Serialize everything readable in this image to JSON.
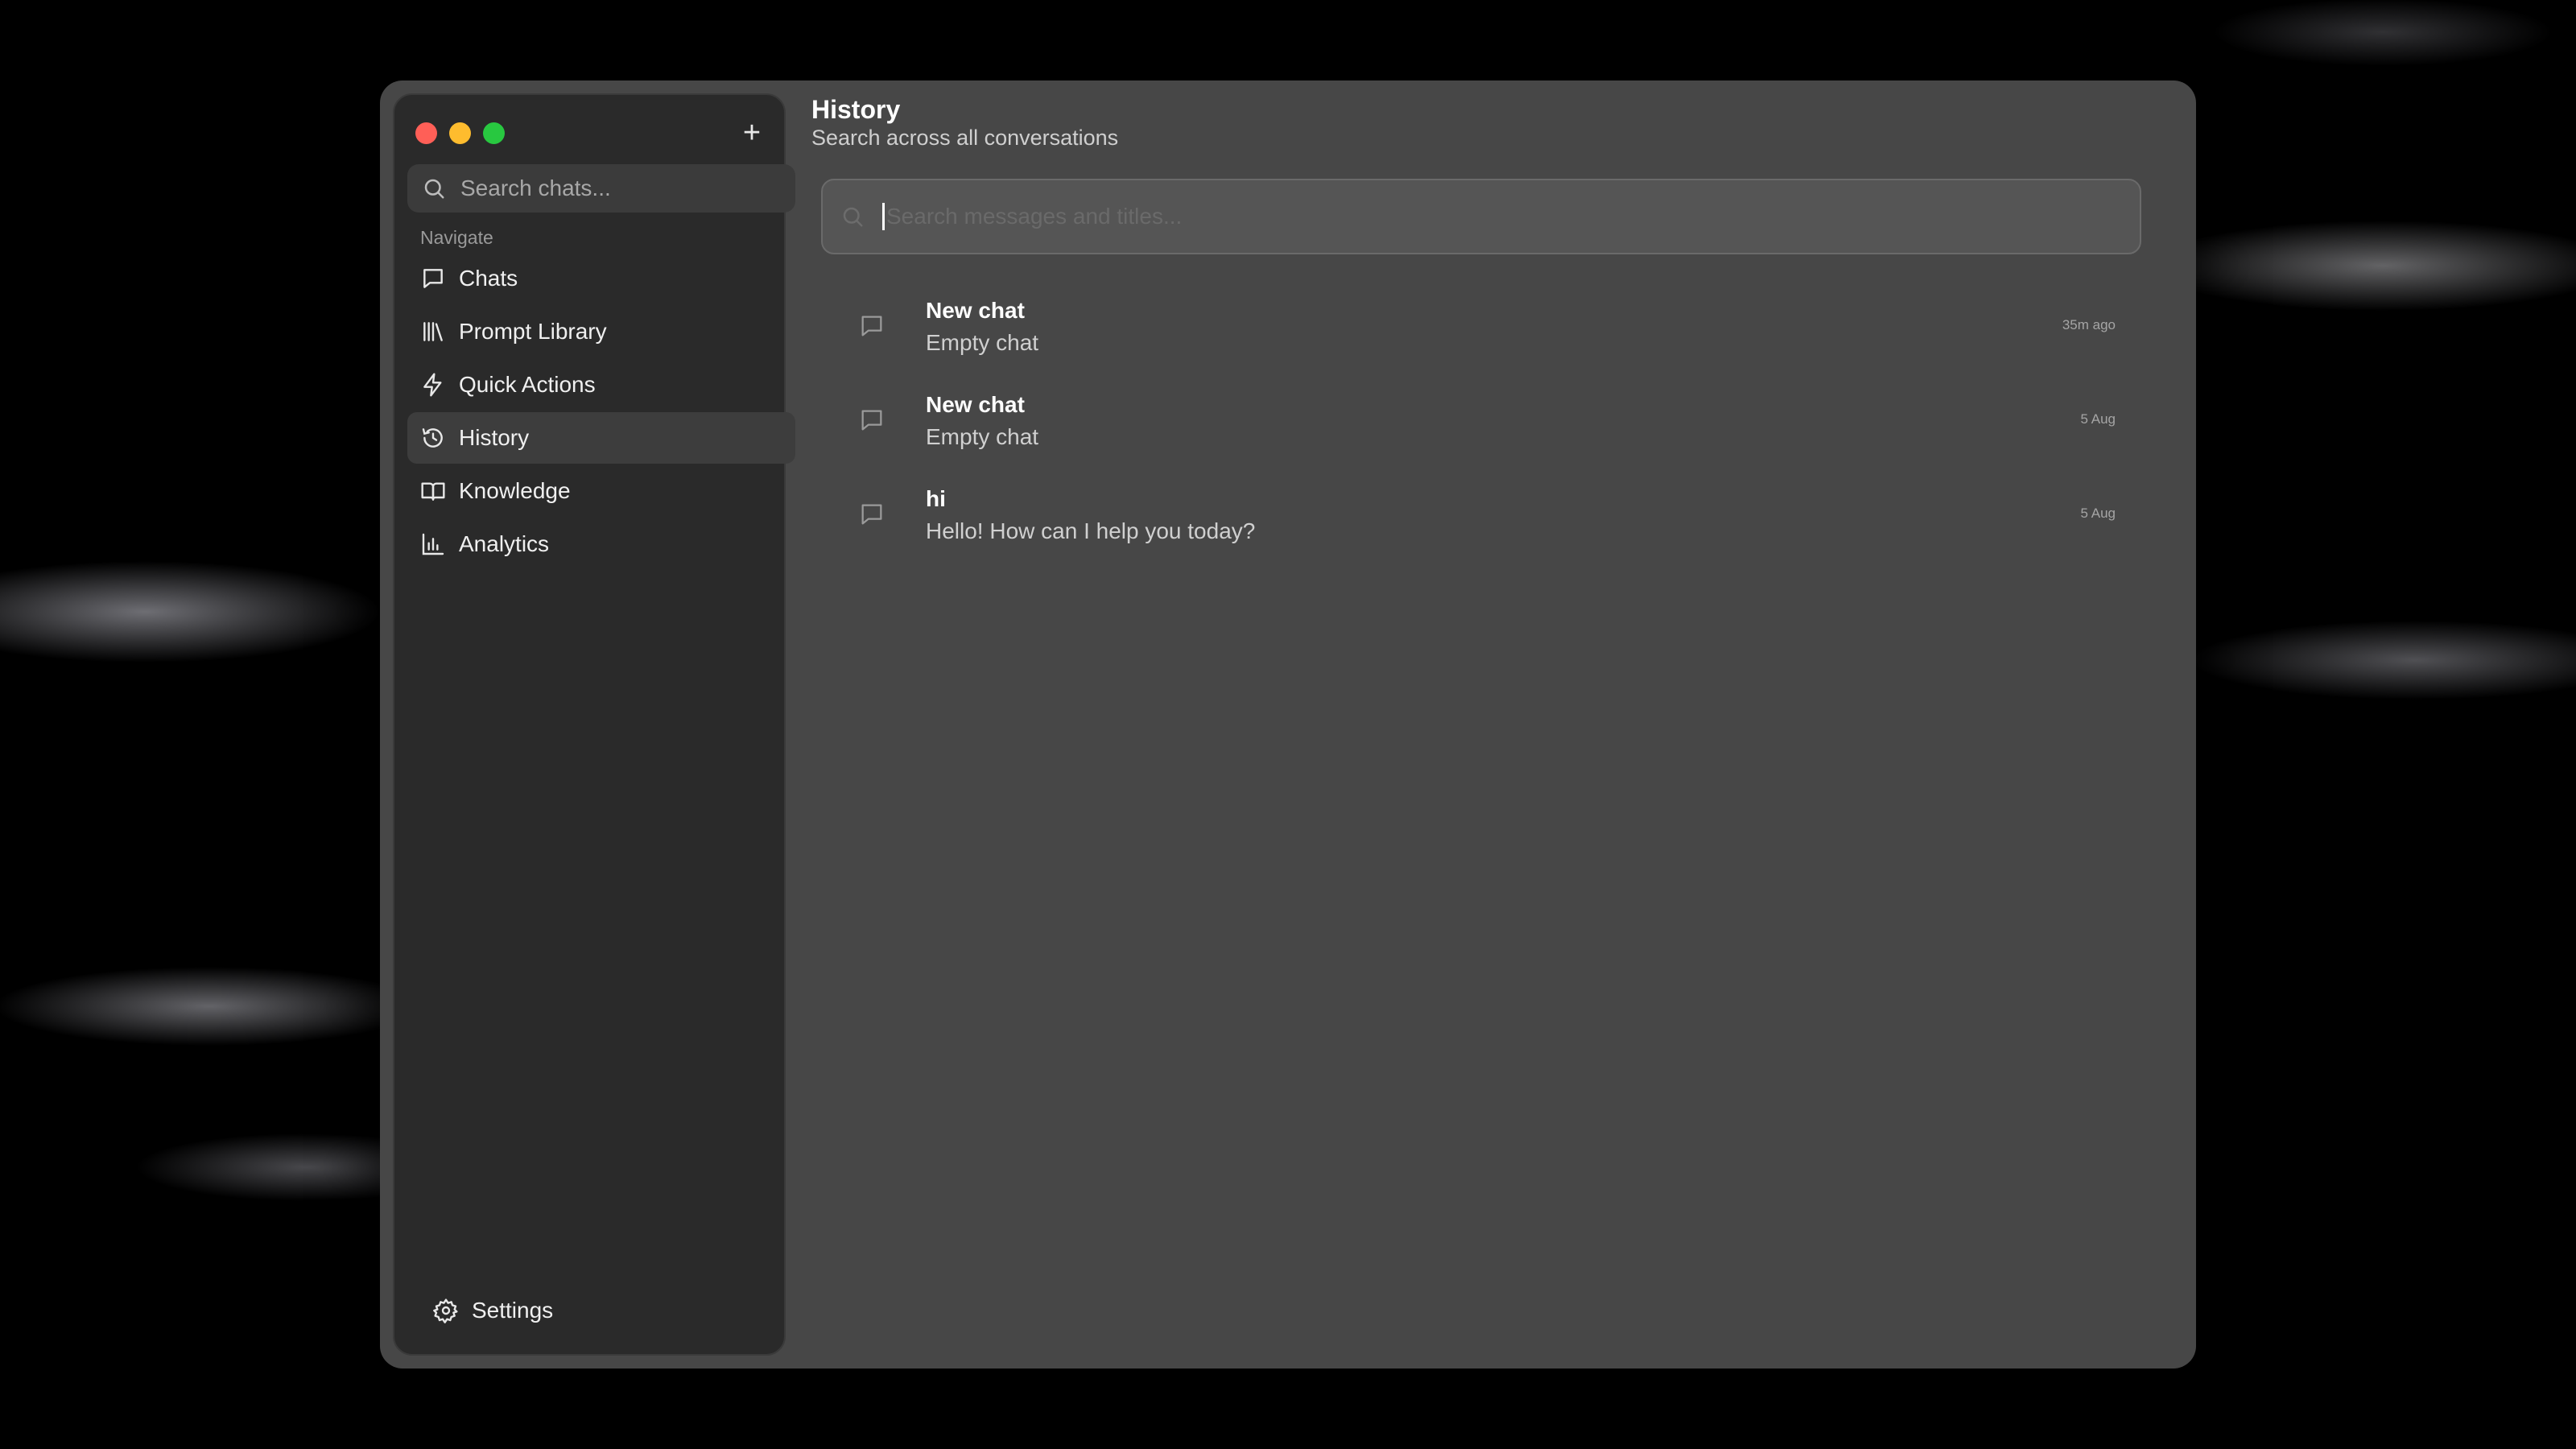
{
  "sidebar": {
    "new_chat_symbol": "+",
    "search_placeholder": "Search chats...",
    "nav_heading": "Navigate",
    "items": [
      {
        "label": "Chats",
        "icon": "chat-bubble-icon"
      },
      {
        "label": "Prompt Library",
        "icon": "library-icon"
      },
      {
        "label": "Quick Actions",
        "icon": "lightning-icon"
      },
      {
        "label": "History",
        "icon": "history-icon",
        "active": true
      },
      {
        "label": "Knowledge",
        "icon": "book-icon"
      },
      {
        "label": "Analytics",
        "icon": "bar-chart-icon"
      }
    ],
    "settings_label": "Settings"
  },
  "main": {
    "title": "History",
    "subtitle": "Search across all conversations",
    "search_placeholder": "Search messages and titles...",
    "conversations": [
      {
        "title": "New chat",
        "snippet": "Empty chat",
        "time": "35m ago"
      },
      {
        "title": "New chat",
        "snippet": "Empty chat",
        "time": "5 Aug"
      },
      {
        "title": "hi",
        "snippet": "Hello! How can I help you today?",
        "time": "5 Aug"
      }
    ]
  },
  "colors": {
    "window_bg": "#474747",
    "sidebar_bg": "#2a2a2a",
    "active_item_bg": "#3d3d3d",
    "close": "#ff5f57",
    "minimize": "#febc2e",
    "zoom": "#28c840"
  }
}
